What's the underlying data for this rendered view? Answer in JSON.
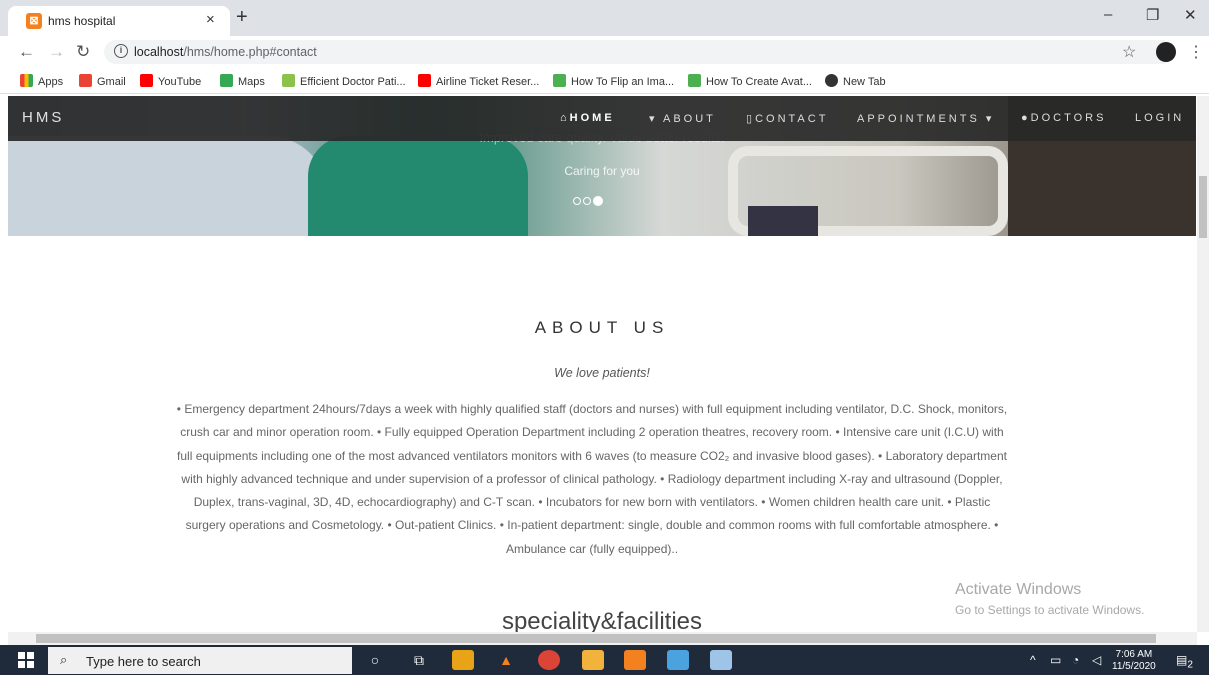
{
  "browser": {
    "tab_title": "hms hospital",
    "tab_close": "×",
    "new_tab": "+",
    "url_host": "localhost",
    "url_path": "/hms/home.php#contact",
    "window_controls": [
      "–",
      "❐",
      "✕"
    ],
    "bookmarks": [
      {
        "label": "Apps",
        "color": "#ea4335"
      },
      {
        "label": "Gmail",
        "color": "#ea4335"
      },
      {
        "label": "YouTube",
        "color": "#ff0000"
      },
      {
        "label": "Maps",
        "color": "#34a853"
      },
      {
        "label": "Efficient Doctor Pati...",
        "color": "#8bc34a"
      },
      {
        "label": "Airline Ticket Reser...",
        "color": "#ff0000"
      },
      {
        "label": "How To Flip an Ima...",
        "color": "#4caf50"
      },
      {
        "label": "How To Create Avat...",
        "color": "#4caf50"
      },
      {
        "label": "New Tab",
        "color": "#333333"
      }
    ]
  },
  "site": {
    "brand": "HMS",
    "nav": {
      "home": "HOME",
      "about": "ABOUT",
      "contact": "CONTACT",
      "appointments": "APPOINTMENTS",
      "doctors": "DOCTORS",
      "login": "LOGIN"
    },
    "hero": {
      "caption_faded": "Improved care quality. Value better results.",
      "caption": "Caring for you"
    },
    "about": {
      "title": "ABOUT US",
      "tagline": "We love patients!",
      "body": "• Emergency department 24hours/7days a week with highly qualified staff (doctors and nurses) with full equipment including ventilator, D.C. Shock, monitors, crush car and minor operation room. • Fully equipped Operation Department including 2 operation theatres, recovery room. • Intensive care unit (I.C.U) with full equipments including one of the most advanced ventilators monitors with 6 waves (to measure CO2₂ and invasive blood gases). • Laboratory department with highly advanced technique and under supervision of a professor of clinical pathology. • Radiology department including X-ray and ultrasound (Doppler, Duplex, trans-vaginal, 3D, 4D, echocardiography) and C-T scan. • Incubators for new born with ventilators. • Women children health care unit. • Plastic surgery operations and Cosmetology. • Out-patient Clinics. • In-patient department: single, double and common rooms with full comfortable atmosphere. • Ambulance car (fully equipped).."
    },
    "specialty_title": "speciality&facilities"
  },
  "watermark": {
    "line1": "Activate Windows",
    "line2": "Go to Settings to activate Windows."
  },
  "taskbar": {
    "search_placeholder": "Type here to search",
    "time": "7:06 AM",
    "date": "11/5/2020",
    "notification_count": "2"
  }
}
